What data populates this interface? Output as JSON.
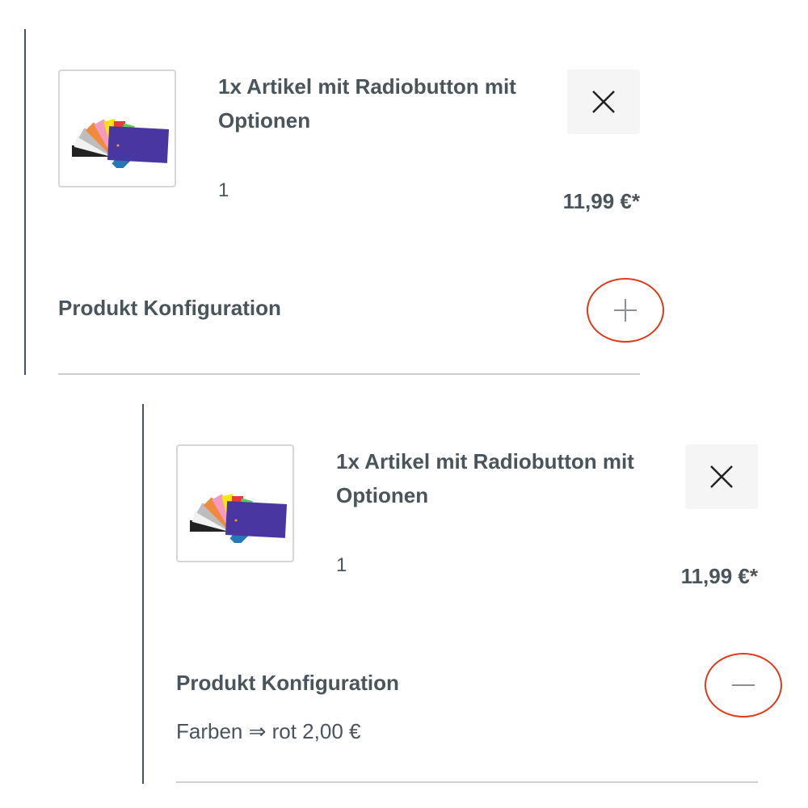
{
  "items": [
    {
      "title": "1x Artikel mit Radiobutton mit Optionen",
      "quantity": "1",
      "price": "11,99 €*",
      "thumbnail": "color-swatch-fan-image",
      "remove_icon": "close-icon",
      "config_label": "Produkt Konfiguration",
      "toggle_icon": "plus-icon",
      "expanded": false
    },
    {
      "title": "1x Artikel mit Radiobutton mit Optionen",
      "quantity": "1",
      "price": "11,99 €*",
      "thumbnail": "color-swatch-fan-image",
      "remove_icon": "close-icon",
      "config_label": "Produkt Konfiguration",
      "toggle_icon": "minus-icon",
      "expanded": true,
      "config_value": "Farben ⇒ rot 2,00 €"
    }
  ],
  "colors": {
    "text": "#4a545b",
    "highlight": "#e0391a",
    "remove_bg": "#f5f5f5",
    "divider": "#cfcfcf"
  }
}
